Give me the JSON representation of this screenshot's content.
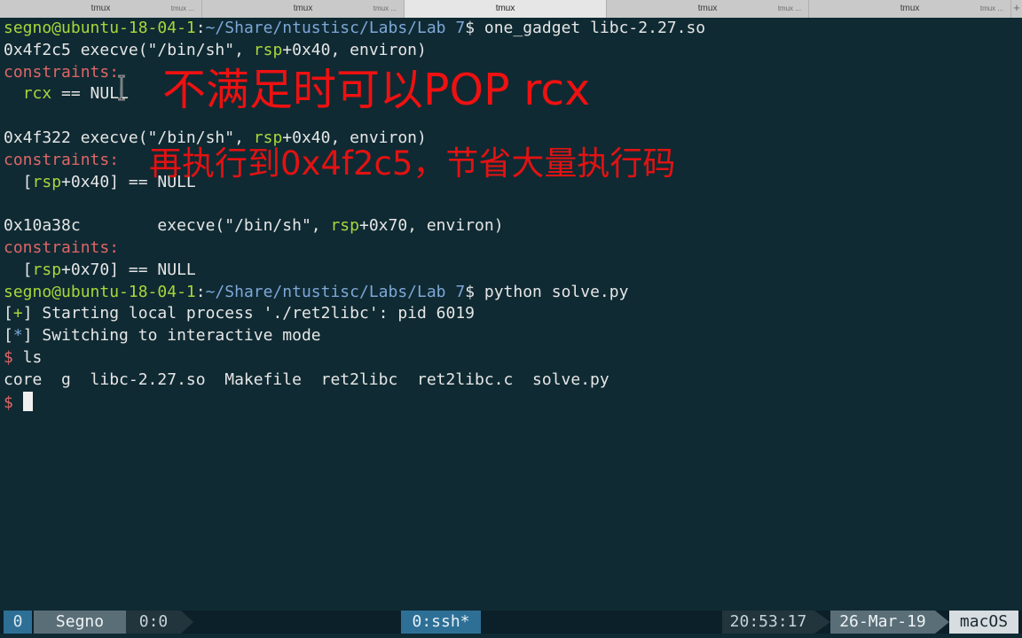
{
  "tabs": [
    {
      "title": "tmux",
      "short": "tmux ..."
    },
    {
      "title": "tmux",
      "short": "tmux ..."
    },
    {
      "title": "tmux",
      "short": "tmux ..."
    },
    {
      "title": "tmux",
      "short": "tmux ..."
    },
    {
      "title": "tmux",
      "short": "tmux ..."
    }
  ],
  "terminal": {
    "lines": [
      [
        {
          "t": "segno@ubuntu-18-04-1",
          "c": "green"
        },
        {
          "t": ":"
        },
        {
          "t": "~/Share/ntustisc/Labs/Lab 7",
          "c": "blue"
        },
        {
          "t": "$ one_gadget libc-2.27.so"
        }
      ],
      [
        {
          "t": "0x4f2c5 execve(\"/bin/sh\", "
        },
        {
          "t": "rsp",
          "c": "green"
        },
        {
          "t": "+0x40, environ)"
        }
      ],
      [
        {
          "t": "constraints:",
          "c": "red"
        }
      ],
      [
        {
          "t": "  "
        },
        {
          "t": "rcx",
          "c": "green"
        },
        {
          "t": " == NULL"
        }
      ],
      [
        {
          "t": ""
        }
      ],
      [
        {
          "t": "0x4f322 execve(\"/bin/sh\", "
        },
        {
          "t": "rsp",
          "c": "green"
        },
        {
          "t": "+0x40, environ)"
        }
      ],
      [
        {
          "t": "constraints:",
          "c": "red"
        }
      ],
      [
        {
          "t": "  ["
        },
        {
          "t": "rsp",
          "c": "green"
        },
        {
          "t": "+0x40] == NULL"
        }
      ],
      [
        {
          "t": ""
        }
      ],
      [
        {
          "t": "0x10a38c        execve(\"/bin/sh\", "
        },
        {
          "t": "rsp",
          "c": "green"
        },
        {
          "t": "+0x70, environ)"
        }
      ],
      [
        {
          "t": "constraints:",
          "c": "red"
        }
      ],
      [
        {
          "t": "  ["
        },
        {
          "t": "rsp",
          "c": "green"
        },
        {
          "t": "+0x70] == NULL"
        }
      ],
      [
        {
          "t": "segno@ubuntu-18-04-1",
          "c": "green"
        },
        {
          "t": ":"
        },
        {
          "t": "~/Share/ntustisc/Labs/Lab 7",
          "c": "blue"
        },
        {
          "t": "$ python solve.py"
        }
      ],
      [
        {
          "t": "["
        },
        {
          "t": "+",
          "c": "green"
        },
        {
          "t": "] Starting local process './ret2libc': pid 6019"
        }
      ],
      [
        {
          "t": "["
        },
        {
          "t": "*",
          "c": "blue"
        },
        {
          "t": "] Switching to interactive mode"
        }
      ],
      [
        {
          "t": "$",
          "c": "red"
        },
        {
          "t": " ls"
        }
      ],
      [
        {
          "t": "core  g  libc-2.27.so  Makefile  ret2libc  ret2libc.c  solve.py"
        }
      ],
      [
        {
          "t": "$ ",
          "c": "red"
        }
      ]
    ]
  },
  "overlay": {
    "line1": "不满足时可以POP rcx",
    "line2": "再执行到0x4f2c5，节省大量执行码"
  },
  "statusbar": {
    "window_index": "0",
    "session": "Segno",
    "pane": "0:0",
    "window": "0:ssh*",
    "time": "20:53:17",
    "date": "26-Mar-19",
    "host": "macOS"
  },
  "colors": {
    "background": "#0f2a33",
    "green": "#a9d63b",
    "blue": "#7ea7d8",
    "red": "#e06666",
    "overlay_red": "#ee1111"
  }
}
